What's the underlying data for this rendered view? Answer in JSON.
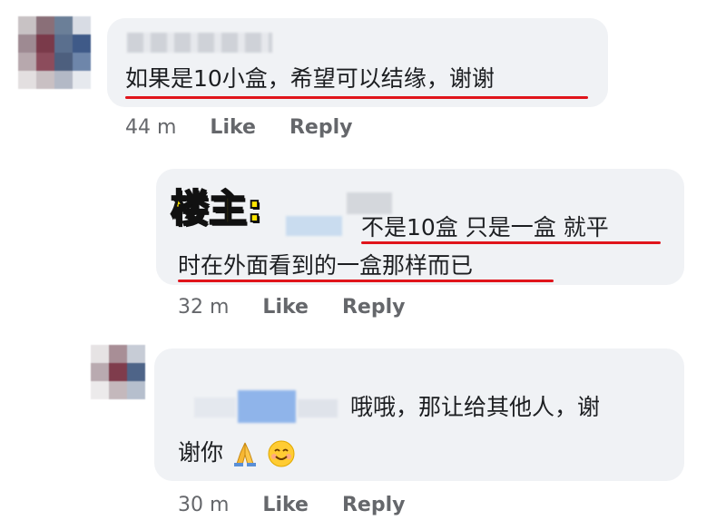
{
  "comments": [
    {
      "text": "如果是10小盒，希望可以结缘，谢谢",
      "time": "44 m",
      "like": "Like",
      "reply": "Reply"
    },
    {
      "poster_label": "楼主:",
      "text_line1": "不是10盒 只是一盒 就平",
      "text_line2": "时在外面看到的一盒那样而已",
      "time": "32 m",
      "like": "Like",
      "reply": "Reply"
    },
    {
      "text_line1": "哦哦，那让给其他人，谢",
      "text_line2": "谢你",
      "emojis": [
        "folded-hands-icon",
        "smiling-face-icon"
      ],
      "time": "30 m",
      "like": "Like",
      "reply": "Reply"
    }
  ],
  "colors": {
    "bubble": "#f0f2f5",
    "underline": "#e0141b",
    "meta": "#65676b",
    "poster_label": "#ffe600"
  }
}
